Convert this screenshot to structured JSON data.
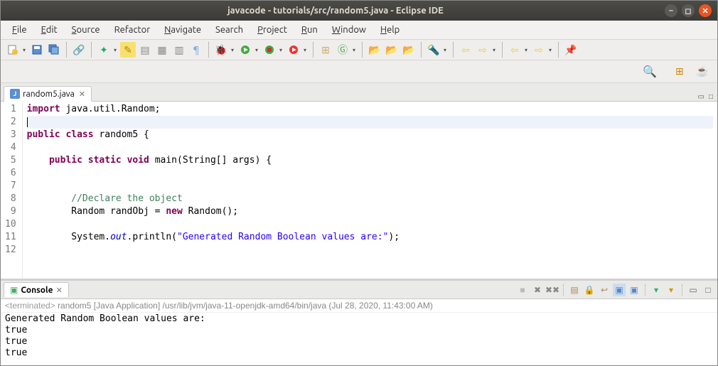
{
  "window": {
    "title": "javacode - tutorials/src/random5.java - Eclipse IDE"
  },
  "menu": {
    "items": [
      "File",
      "Edit",
      "Source",
      "Refactor",
      "Navigate",
      "Search",
      "Project",
      "Run",
      "Window",
      "Help"
    ]
  },
  "editor": {
    "tab": {
      "label": "random5.java",
      "close": "✕"
    },
    "lines": [
      {
        "n": 1,
        "html": "<span class='kw'>import</span> java.util.Random;"
      },
      {
        "n": 2,
        "html": "<span class='cursor'></span>",
        "current": true
      },
      {
        "n": 3,
        "html": "<span class='kw'>public</span> <span class='kw'>class</span> random5 {"
      },
      {
        "n": 4,
        "html": ""
      },
      {
        "n": 5,
        "html": "    <span class='kw'>public</span> <span class='kw'>static</span> <span class='kw'>void</span> main(String[] args) {",
        "marker": true
      },
      {
        "n": 6,
        "html": ""
      },
      {
        "n": 7,
        "html": ""
      },
      {
        "n": 8,
        "html": "        <span class='com'>//Declare the object</span>"
      },
      {
        "n": 9,
        "html": "        Random randObj = <span class='kw'>new</span> Random();"
      },
      {
        "n": 10,
        "html": ""
      },
      {
        "n": 11,
        "html": "        System.<span class='fld'>out</span>.println(<span class='str'>\"Generated Random Boolean values are:\"</span>);"
      },
      {
        "n": 12,
        "html": ""
      }
    ]
  },
  "console": {
    "tab": "Console",
    "status_prefix": "<terminated>",
    "status": "random5 [Java Application] /usr/lib/jvm/java-11-openjdk-amd64/bin/java (Jul 28, 2020, 11:43:00 AM)",
    "output": "Generated Random Boolean values are:\ntrue\ntrue\ntrue"
  }
}
